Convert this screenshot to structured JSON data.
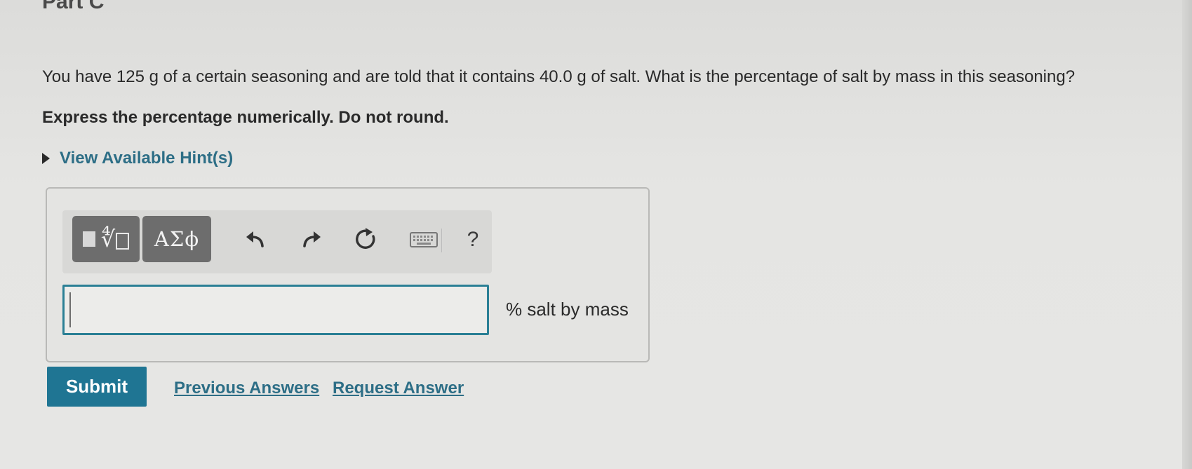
{
  "part": {
    "title": "Part C"
  },
  "question": {
    "text": "You have 125 g of a certain seasoning and are told that it contains 40.0 g of salt. What is the percentage of salt by mass in this seasoning?",
    "instruction": "Express the percentage numerically. Do not round."
  },
  "hints": {
    "label": "View Available Hint(s)"
  },
  "toolbar": {
    "greek_label": "ΑΣϕ",
    "help_label": "?",
    "icons": [
      "templates-icon",
      "greek-symbols-icon",
      "undo-icon",
      "redo-icon",
      "reset-icon",
      "keyboard-icon",
      "help-icon"
    ]
  },
  "answer": {
    "value": "",
    "units": "% salt by mass"
  },
  "actions": {
    "submit": "Submit",
    "previous_answers": "Previous Answers",
    "request_answer": "Request Answer"
  },
  "colors": {
    "accent": "#1f7593",
    "link": "#2d6e86",
    "input_border": "#2a7f95",
    "toolbar_button": "#6d6d6d"
  }
}
